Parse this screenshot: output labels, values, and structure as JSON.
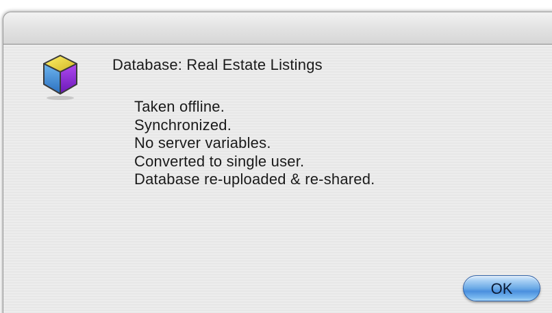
{
  "dialog": {
    "icon": "database-cube-icon",
    "heading": "Database: Real Estate Listings",
    "messages": [
      "Taken offline.",
      "Synchronized.",
      "No server variables.",
      "Converted to single user.",
      "Database re-uploaded & re-shared."
    ],
    "ok_label": "OK"
  },
  "colors": {
    "dialog_background": "#ececec",
    "ok_button": "#6aa9e6",
    "icon_top": "#e8d43a",
    "icon_left": "#3a8fd8",
    "icon_right": "#8b2fe0"
  }
}
